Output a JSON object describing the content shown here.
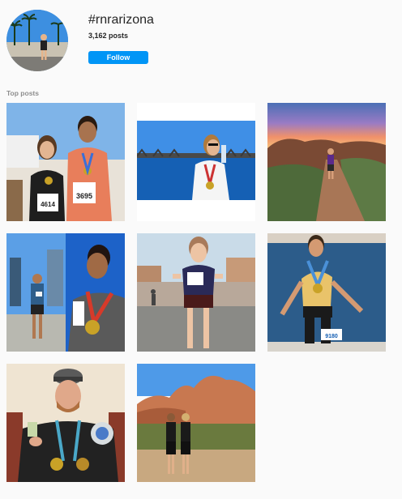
{
  "hashtag": {
    "name": "#rnrarizona",
    "posts_count": "3,162",
    "posts_label": "posts",
    "follow_label": "Follow"
  },
  "section": {
    "title": "Top posts"
  },
  "post_texts": {
    "bib_1": "4614",
    "bib_2": "3695",
    "bib_6": "9180"
  },
  "posts": [
    {
      "id": 1,
      "icon": "photo"
    },
    {
      "id": 2,
      "icon": "photo"
    },
    {
      "id": 3,
      "icon": "photo"
    },
    {
      "id": 4,
      "icon": "photo"
    },
    {
      "id": 5,
      "icon": "photo"
    },
    {
      "id": 6,
      "icon": "photo"
    },
    {
      "id": 7,
      "icon": "photo"
    },
    {
      "id": 8,
      "icon": "photo"
    }
  ],
  "colors": {
    "accent": "#0095f6",
    "background": "#fafafa",
    "text": "#262626",
    "muted": "#8e8e8e"
  }
}
